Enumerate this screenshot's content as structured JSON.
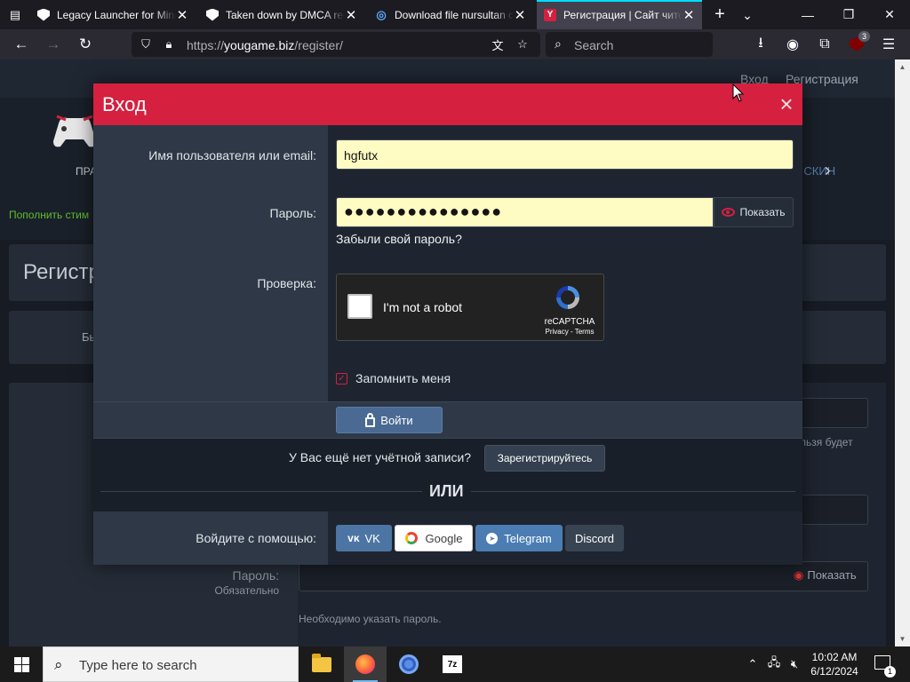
{
  "browser": {
    "tabs": [
      {
        "title": "Legacy Launcher for Minecraft",
        "favicon": "shield-icon"
      },
      {
        "title": "Taken down by DMCA request",
        "favicon": "shield-icon"
      },
      {
        "title": "Download file nursultan client",
        "favicon": "swirl-icon"
      },
      {
        "title": "Регистрация | Сайт читов",
        "favicon": "yougame-icon",
        "active": true
      }
    ],
    "url_prefix": "https://",
    "url_host": "yougame.biz",
    "url_path": "/register/",
    "search_placeholder": "Search",
    "extension_badge": "3"
  },
  "page": {
    "header_links": [
      "Вход",
      "Регистрация"
    ],
    "logo_text": "ПРА",
    "skin_link": "ь СКИН",
    "topup_text": "Пополнить стим",
    "register_title": "Регистр",
    "info_text": "Бы",
    "note_text": "льзя будет",
    "password_label": "Пароль:",
    "required_label": "Обязательно",
    "show_label": "Показать",
    "password_hint": "Необходимо указать пароль."
  },
  "modal": {
    "title": "Вход",
    "close_glyph": "×",
    "username_label": "Имя пользователя или email:",
    "username_value": "hgfutx",
    "password_label": "Пароль:",
    "password_mask": "●●●●●●●●●●●●●●●",
    "show_password": "Показать",
    "forgot_link": "Забыли свой пароль?",
    "captcha_label": "Проверка:",
    "captcha_text": "I'm not a robot",
    "captcha_brand": "reCAPTCHA",
    "captcha_terms": "Privacy - Terms",
    "remember_label": "Запомнить меня",
    "remember_checked": true,
    "login_button": "Войти",
    "no_account_text": "У Вас ещё нет учётной записи?",
    "register_button": "Зарегистрируйтесь",
    "or_text": "ИЛИ",
    "social_label": "Войдите с помощью:",
    "social_buttons": [
      {
        "label": "VK",
        "icon": "vk-icon"
      },
      {
        "label": "Google",
        "icon": "google-icon"
      },
      {
        "label": "Telegram",
        "icon": "telegram-icon"
      },
      {
        "label": "Discord",
        "icon": ""
      }
    ],
    "accent_color": "#d5203f"
  },
  "taskbar": {
    "search_placeholder": "Type here to search",
    "time": "10:02 AM",
    "date": "6/12/2024",
    "notification_count": "1"
  }
}
